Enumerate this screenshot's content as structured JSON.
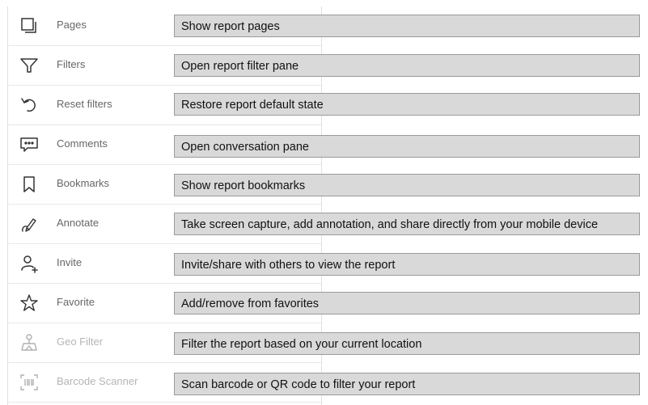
{
  "menu": {
    "items": [
      {
        "label": "Pages",
        "icon": "pages-icon",
        "enabled": true
      },
      {
        "label": "Filters",
        "icon": "filter-icon",
        "enabled": true
      },
      {
        "label": "Reset filters",
        "icon": "undo-icon",
        "enabled": true
      },
      {
        "label": "Comments",
        "icon": "comment-icon",
        "enabled": true
      },
      {
        "label": "Bookmarks",
        "icon": "bookmark-icon",
        "enabled": true
      },
      {
        "label": "Annotate",
        "icon": "annotate-pen-icon",
        "enabled": true
      },
      {
        "label": "Invite",
        "icon": "add-person-icon",
        "enabled": true
      },
      {
        "label": "Favorite",
        "icon": "star-icon",
        "enabled": true
      },
      {
        "label": "Geo Filter",
        "icon": "geo-pin-icon",
        "enabled": false
      },
      {
        "label": "Barcode Scanner",
        "icon": "barcode-icon",
        "enabled": false
      }
    ]
  },
  "callouts": [
    "Show report pages",
    "Open report filter pane",
    "Restore report default state",
    "Open conversation pane",
    "Show report bookmarks",
    "Take screen capture, add annotation, and share directly from your mobile device",
    "Invite/share with others to view the report",
    "Add/remove from favorites",
    "Filter the report based on your current location",
    "Scan barcode or QR code to filter your report"
  ],
  "colors": {
    "label": "#666666",
    "label_disabled": "#b5b5b5",
    "callout_bg": "#d9d9d9",
    "callout_border": "#9a9a9a",
    "icon": "#333333",
    "icon_disabled": "#b0b0b0"
  }
}
